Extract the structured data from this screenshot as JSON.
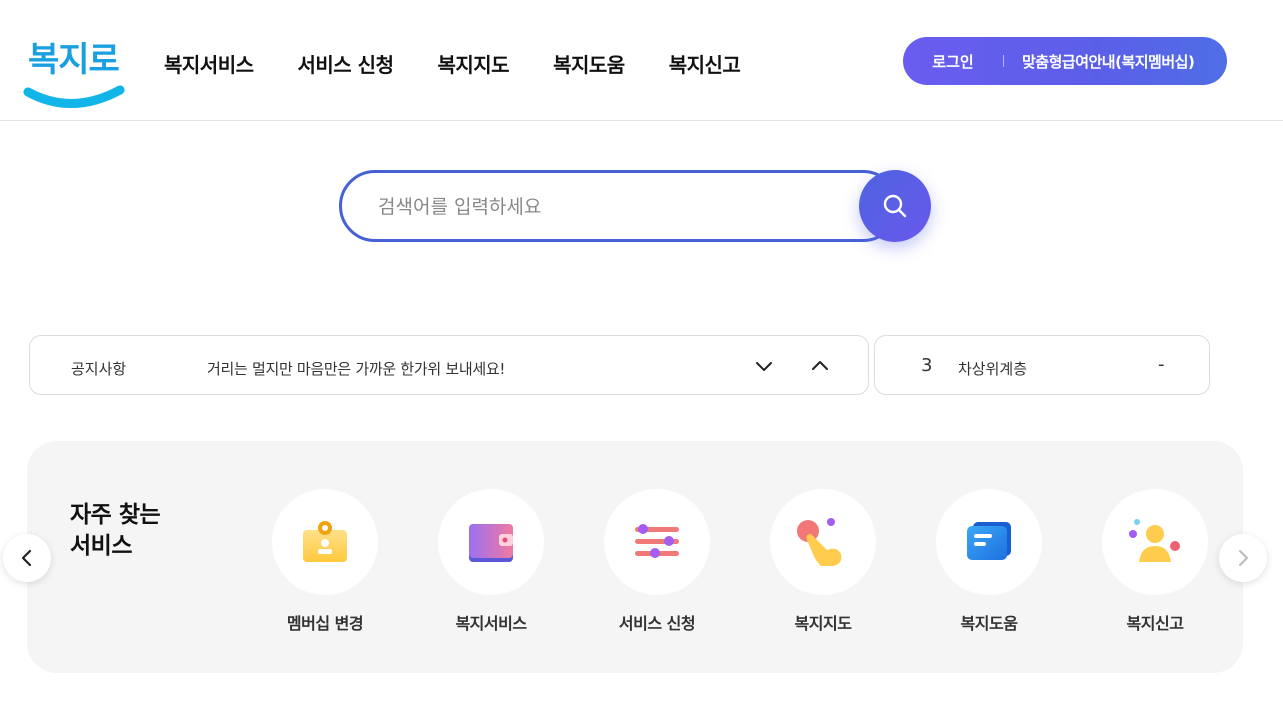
{
  "logo": {
    "text": "복지로",
    "color": "#1a9fe0",
    "swoosh_color": "#12b5e8"
  },
  "nav": {
    "items": [
      "복지서비스",
      "서비스 신청",
      "복지지도",
      "복지도움",
      "복지신고"
    ]
  },
  "auth": {
    "login": "로그인",
    "guide": "맞춤형급여안내(복지멤버십)",
    "gradient": [
      "#6a5cf0",
      "#4f6ee6"
    ]
  },
  "search": {
    "placeholder": "검색어를 입력하세요",
    "value": "",
    "border_color": "#4660d6",
    "icon": "search-icon"
  },
  "notice": {
    "label": "공지사항",
    "text": "거리는 멀지만 마음만은 가까운 한가위 보내세요!",
    "down_icon": "chevron-down-icon",
    "up_icon": "chevron-up-icon"
  },
  "rank": {
    "number": "3",
    "keyword": "차상위계층",
    "change": "-"
  },
  "frequent": {
    "title_line1": "자주 찾는",
    "title_line2": "서비스",
    "items": [
      {
        "label": "멤버십 변경",
        "icon": "membership-card-icon"
      },
      {
        "label": "복지서비스",
        "icon": "wallet-icon"
      },
      {
        "label": "서비스 신청",
        "icon": "sliders-icon"
      },
      {
        "label": "복지지도",
        "icon": "pointing-hand-icon"
      },
      {
        "label": "복지도움",
        "icon": "chat-bubble-icon"
      },
      {
        "label": "복지신고",
        "icon": "person-icon"
      }
    ]
  },
  "carousel": {
    "prev_icon": "chevron-left-icon",
    "next_icon": "chevron-right-icon"
  }
}
